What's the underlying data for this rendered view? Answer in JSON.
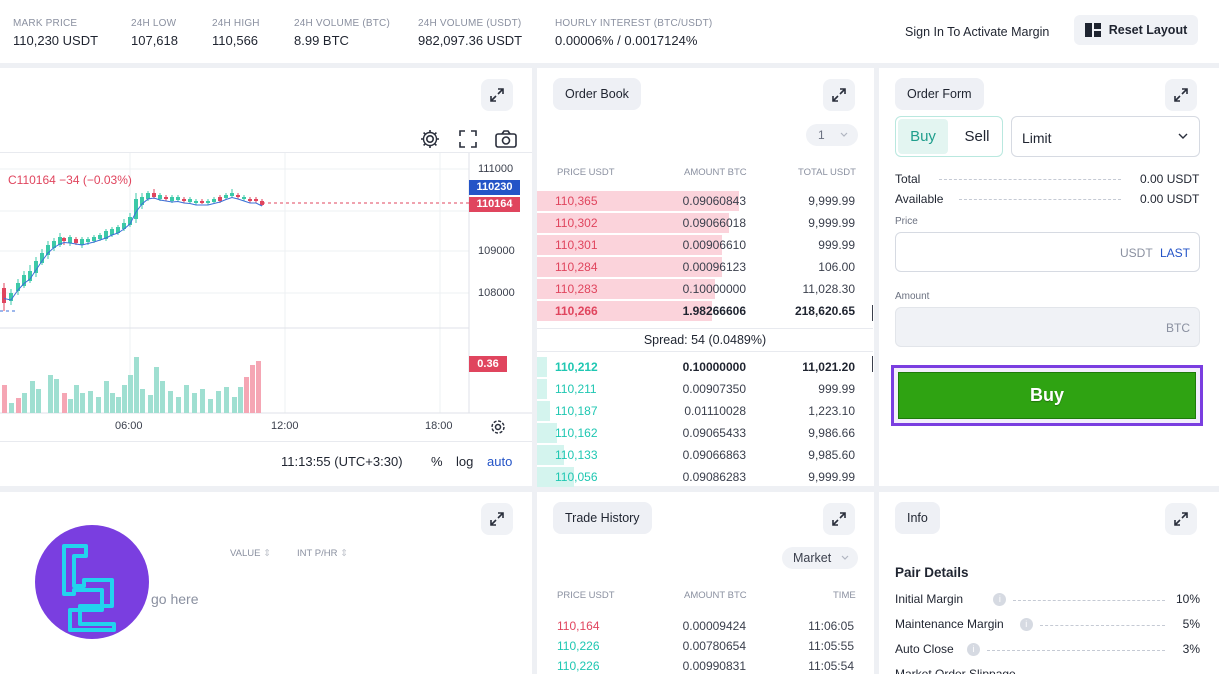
{
  "stats": [
    {
      "label": "MARK PRICE",
      "value": "110,230 USDT"
    },
    {
      "label": "24H LOW",
      "value": "107,618"
    },
    {
      "label": "24H HIGH",
      "value": "110,566"
    },
    {
      "label": "24H VOLUME (BTC)",
      "value": "8.99 BTC"
    },
    {
      "label": "24H VOLUME (USDT)",
      "value": "982,097.36 USDT"
    },
    {
      "label": "HOURLY INTEREST (BTC/USDT)",
      "value": "0.00006% / 0.0017124%"
    }
  ],
  "header": {
    "signin": "Sign In To Activate Margin",
    "reset": "Reset Layout"
  },
  "chart": {
    "ohlc_text": "C110164  −34 (−0.03%)",
    "price_ticks": [
      "111000",
      "109000",
      "108000"
    ],
    "mark_badge": "110230",
    "last_badge": "110164",
    "vol_badge": "0.36",
    "time_ticks": [
      "06:00",
      "12:00",
      "18:00"
    ],
    "clock": "11:13:55 (UTC+3:30)",
    "opt_pct": "%",
    "opt_log": "log",
    "opt_auto": "auto",
    "colors": {
      "up": "#3cc9a8",
      "down": "#e0455e",
      "ma": "#3b6fd8"
    }
  },
  "orderbook": {
    "title": "Order Book",
    "depth": "1",
    "headers": [
      "PRICE USDT",
      "AMOUNT BTC",
      "TOTAL USDT"
    ],
    "asks": [
      {
        "price": "110,365",
        "amount": "0.09060843",
        "total": "9,999.99",
        "depth": 0.6
      },
      {
        "price": "110,302",
        "amount": "0.09066018",
        "total": "9,999.99",
        "depth": 0.57
      },
      {
        "price": "110,301",
        "amount": "0.00906610",
        "total": "999.99",
        "depth": 0.55
      },
      {
        "price": "110,284",
        "amount": "0.00096123",
        "total": "106.00",
        "depth": 0.55
      },
      {
        "price": "110,283",
        "amount": "0.10000000",
        "total": "11,028.30",
        "depth": 0.53
      },
      {
        "price": "110,266",
        "amount": "1.98266606",
        "total": "218,620.65",
        "depth": 0.52
      }
    ],
    "spread": "Spread: 54 (0.0489%)",
    "bids": [
      {
        "price": "110,212",
        "amount": "0.10000000",
        "total": "11,021.20",
        "depth": 0.03
      },
      {
        "price": "110,211",
        "amount": "0.00907350",
        "total": "999.99",
        "depth": 0.03
      },
      {
        "price": "110,187",
        "amount": "0.01110028",
        "total": "1,223.10",
        "depth": 0.04
      },
      {
        "price": "110,162",
        "amount": "0.09065433",
        "total": "9,986.66",
        "depth": 0.06
      },
      {
        "price": "110,133",
        "amount": "0.09066863",
        "total": "9,985.60",
        "depth": 0.08
      },
      {
        "price": "110,056",
        "amount": "0.09086283",
        "total": "9,999.99",
        "depth": 0.11
      }
    ]
  },
  "orderform": {
    "title": "Order Form",
    "buy_tab": "Buy",
    "sell_tab": "Sell",
    "type": "Limit",
    "total_label": "Total",
    "total_value": "0.00 USDT",
    "available_label": "Available",
    "available_value": "0.00 USDT",
    "price_label": "Price",
    "price_unit": "USDT",
    "price_last": "LAST",
    "amount_label": "Amount",
    "amount_unit": "BTC",
    "buy_button": "Buy"
  },
  "positions": {
    "col_value": "VALUE",
    "col_int": "INT P/HR",
    "empty": "go here"
  },
  "trades": {
    "title": "Trade History",
    "filter": "Market",
    "headers": [
      "PRICE USDT",
      "AMOUNT BTC",
      "TIME"
    ],
    "rows": [
      {
        "price": "110,164",
        "amount": "0.00009424",
        "time": "11:06:05",
        "side": "sell"
      },
      {
        "price": "110,226",
        "amount": "0.00780654",
        "time": "11:05:55",
        "side": "buy"
      },
      {
        "price": "110,226",
        "amount": "0.00990831",
        "time": "11:05:54",
        "side": "buy"
      }
    ]
  },
  "info": {
    "title": "Info",
    "section": "Pair Details",
    "rows": [
      {
        "label": "Initial Margin",
        "value": "10%"
      },
      {
        "label": "Maintenance Margin",
        "value": "5%"
      },
      {
        "label": "Auto Close",
        "value": "3%"
      },
      {
        "label": "Market Order Slippage",
        "value": ""
      }
    ]
  }
}
